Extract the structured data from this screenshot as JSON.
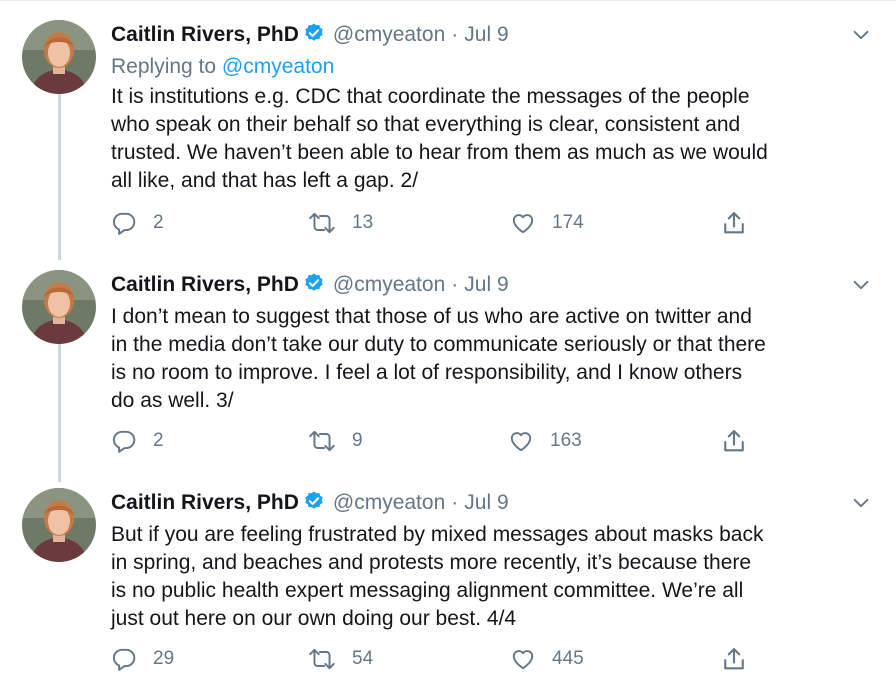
{
  "tweets": [
    {
      "author": "Caitlin Rivers, PhD",
      "handle": "@cmyeaton",
      "separator": "·",
      "date": "Jul 9",
      "replying_label": "Replying to",
      "replying_handle": "@cmyeaton",
      "lines": [
        "It is institutions e.g. CDC that coordinate the messages of the people",
        "who speak on their behalf so that everything is clear, consistent and",
        "trusted. We haven’t been able to hear from them as much as we would",
        "all like, and that has left a gap. 2/"
      ],
      "replies": "2",
      "retweets": "13",
      "likes": "174"
    },
    {
      "author": "Caitlin Rivers, PhD",
      "handle": "@cmyeaton",
      "separator": "·",
      "date": "Jul 9",
      "lines": [
        "I don’t mean to suggest that those of us who are active on twitter and",
        "in the media don’t take our duty to communicate seriously or that there",
        "is no room to improve.  I feel a lot of responsibility, and I know others",
        "do as well. 3/"
      ],
      "replies": "2",
      "retweets": "9",
      "likes": "163"
    },
    {
      "author": "Caitlin Rivers, PhD",
      "handle": "@cmyeaton",
      "separator": "·",
      "date": "Jul 9",
      "lines": [
        "But if you are feeling frustrated by mixed messages about masks back",
        "in spring, and beaches and protests more recently, it’s because there",
        "is no public health expert messaging alignment committee. We’re all",
        "just out here on our own doing our best. 4/4"
      ],
      "replies": "29",
      "retweets": "54",
      "likes": "445"
    }
  ],
  "colors": {
    "text": "#14171a",
    "muted": "#657786",
    "link": "#1da1f2",
    "thread_line": "#ccd6dd"
  },
  "icons": [
    "verified-badge-icon",
    "chevron-down-icon",
    "reply-icon",
    "retweet-icon",
    "like-icon",
    "share-icon"
  ]
}
